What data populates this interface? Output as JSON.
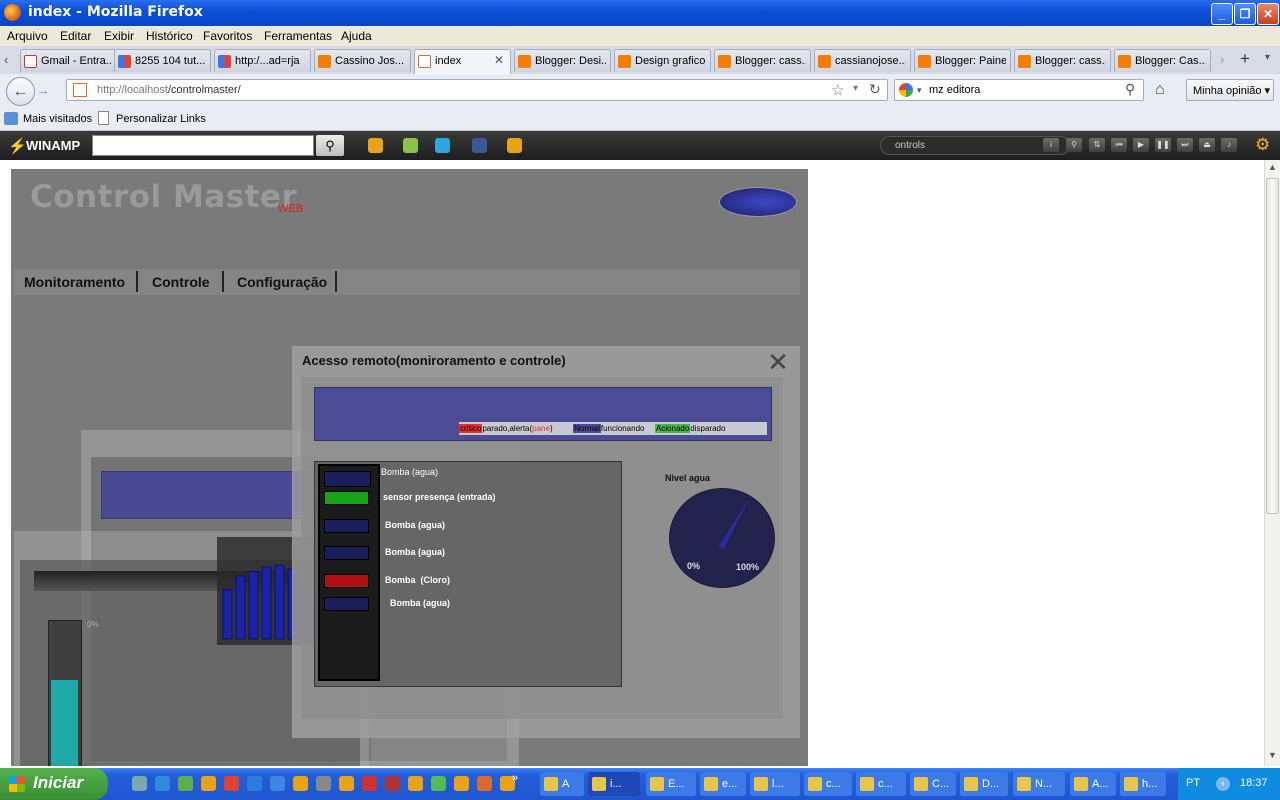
{
  "window": {
    "title": "index - Mozilla Firefox"
  },
  "menu": [
    "Arquivo",
    "Editar",
    "Exibir",
    "Histórico",
    "Favoritos",
    "Ferramentas",
    "Ajuda"
  ],
  "tabs": [
    {
      "label": "Gmail - Entra...",
      "icon": "gmail"
    },
    {
      "label": "8255 104 tut...",
      "icon": "goog"
    },
    {
      "label": "http:/...ad=rja",
      "icon": "goog"
    },
    {
      "label": "Cassino Jos...",
      "icon": "blog"
    },
    {
      "label": "index",
      "icon": "page",
      "active": true
    },
    {
      "label": "Blogger: Desi...",
      "icon": "blog"
    },
    {
      "label": "Design grafico",
      "icon": "blog"
    },
    {
      "label": "Blogger: cass...",
      "icon": "blog"
    },
    {
      "label": "cassianojose...",
      "icon": "blog"
    },
    {
      "label": "Blogger: Painel",
      "icon": "blog"
    },
    {
      "label": "Blogger: cass...",
      "icon": "blog"
    },
    {
      "label": "Blogger: Cas...",
      "icon": "blog"
    }
  ],
  "nav": {
    "url_host": "http://localhost",
    "url_path": "/controlmaster/",
    "search_value": "mz editora",
    "opinion": "Minha opinião"
  },
  "bookmarks": {
    "most_visited": "Mais visitados",
    "custom_links": "Personalizar Links"
  },
  "winamp": {
    "logo": "WINAMP",
    "now_playing": "ontrols"
  },
  "app": {
    "title": "Control Master",
    "title_suffix": "WEB",
    "nav": [
      "Monitoramento",
      "Controle",
      "Configuração"
    ],
    "dialog_title": "Acesso remoto(moniroramento e controle)",
    "legend": {
      "critico": "crítico",
      "critico_rest": "parado,alerta(",
      "pane": "pane",
      "close_paren": ")",
      "normal": "Normal",
      "normal_rest": "funcionando",
      "acionado": "Acionado",
      "acionado_rest": "disparado"
    },
    "devices_header": "Bomba (agua)",
    "devices": [
      {
        "label": "sensor presença (entrada)",
        "color": "#16a316"
      },
      {
        "label": "Bomba (agua)",
        "color": "#1a1f5a"
      },
      {
        "label": "Bomba (agua)",
        "color": "#1a1f5a"
      },
      {
        "label": "Bomba  (Cloro)",
        "color": "#b01010"
      },
      {
        "label": "Bomba (agua)",
        "color": "#1a1f5a"
      }
    ],
    "gauge": {
      "label": "Nivel agua",
      "min_label": "0%",
      "max_label": "100%"
    },
    "ghost_pct": "0%"
  },
  "chart_data": {
    "type": "bar",
    "values": [
      55,
      70,
      75,
      80,
      82,
      78,
      70,
      60
    ],
    "ylim": [
      0,
      100
    ]
  },
  "taskbar": {
    "start": "Iniciar",
    "tasks": [
      "A",
      "i...",
      "E...",
      "e...",
      "l...",
      "c...",
      "c...",
      "C...",
      "D...",
      "N...",
      "A...",
      "h..."
    ],
    "lang": "PT",
    "time": "18:37"
  },
  "colors": {
    "title_blue": "#0b4fd8",
    "page_gray": "#7a7a7a",
    "legend_red": "#e8312a",
    "legend_green": "#49b849",
    "app_navy": "#23224d"
  }
}
